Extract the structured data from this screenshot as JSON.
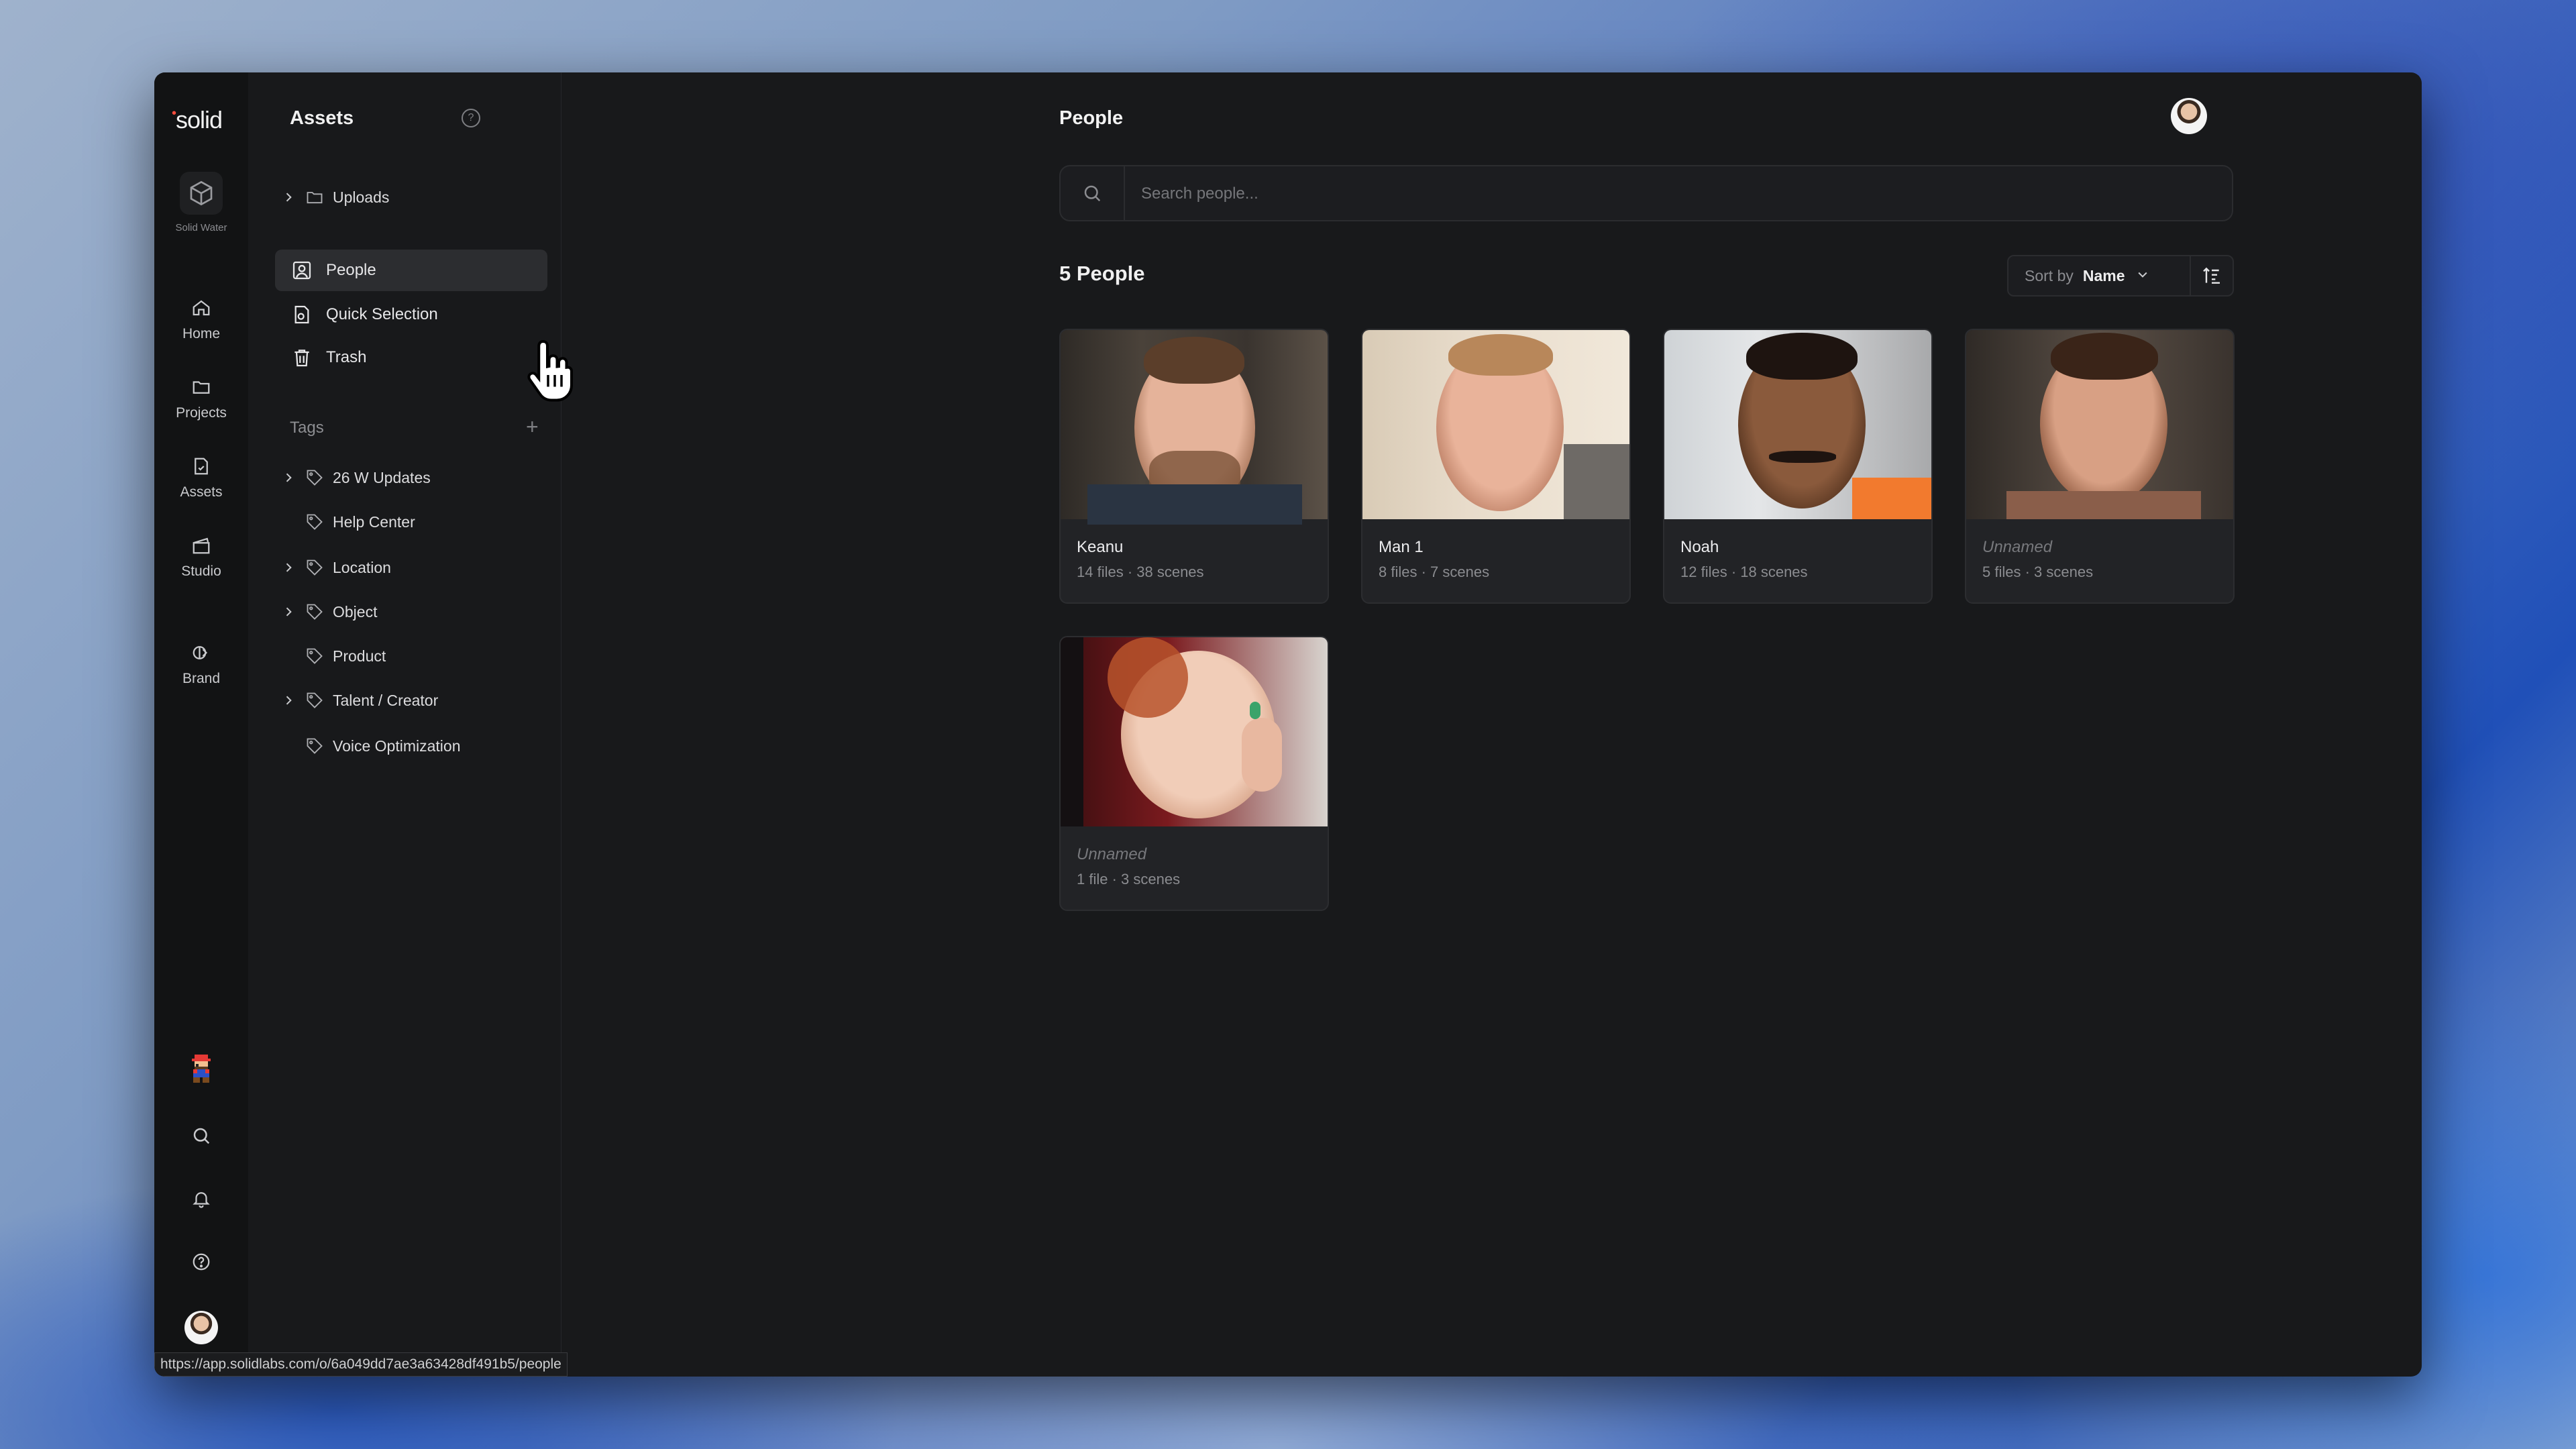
{
  "app": {
    "logo_text": "solid",
    "workspace_label": "Solid Water"
  },
  "rail": {
    "items": [
      {
        "label": "Home",
        "icon": "home-icon"
      },
      {
        "label": "Projects",
        "icon": "folder-icon"
      },
      {
        "label": "Assets",
        "icon": "assets-icon"
      },
      {
        "label": "Studio",
        "icon": "studio-icon"
      },
      {
        "label": "Brand",
        "icon": "brand-icon"
      }
    ]
  },
  "sidebar": {
    "title": "Assets",
    "uploads_label": "Uploads",
    "nav": [
      {
        "label": "People",
        "icon": "person-square-icon",
        "active": true
      },
      {
        "label": "Quick Selection",
        "icon": "quick-selection-icon",
        "active": false
      },
      {
        "label": "Trash",
        "icon": "trash-icon",
        "active": false
      }
    ],
    "tags_header": "Tags",
    "tags": [
      {
        "label": "26 W Updates",
        "expandable": true
      },
      {
        "label": "Help Center",
        "expandable": false
      },
      {
        "label": "Location",
        "expandable": true
      },
      {
        "label": "Object",
        "expandable": true
      },
      {
        "label": "Product",
        "expandable": false
      },
      {
        "label": "Talent / Creator",
        "expandable": true
      },
      {
        "label": "Voice Optimization",
        "expandable": false
      }
    ]
  },
  "main": {
    "title": "People",
    "search_placeholder": "Search people...",
    "count_label": "5 People",
    "sort_label": "Sort by",
    "sort_value": "Name"
  },
  "people": [
    {
      "name": "Keanu",
      "meta": "14 files · 38 scenes",
      "unnamed": false
    },
    {
      "name": "Man 1",
      "meta": "8 files · 7 scenes",
      "unnamed": false
    },
    {
      "name": "Noah",
      "meta": "12 files · 18 scenes",
      "unnamed": false
    },
    {
      "name": "Unnamed",
      "meta": "5 files · 3 scenes",
      "unnamed": true
    },
    {
      "name": "Unnamed",
      "meta": "1 file · 3 scenes",
      "unnamed": true
    }
  ],
  "status_url": "https://app.solidlabs.com/o/6a049dd7ae3a63428df491b5/people",
  "colors": {
    "accent_red": "#ff4d3d",
    "background": "#18191b",
    "card": "#222326"
  }
}
